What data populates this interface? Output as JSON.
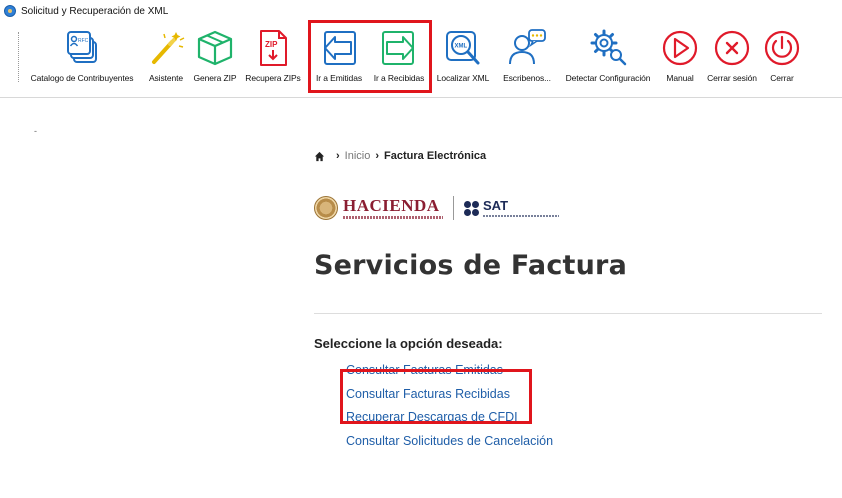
{
  "window": {
    "title": "Solicitud y Recuperación de XML"
  },
  "toolbar": {
    "buttons": [
      {
        "label": "Catalogo de Contribuyentes",
        "icon": "rfc-cards-icon",
        "badge": "RFC"
      },
      {
        "label": "Asistente",
        "icon": "magic-wand-icon"
      },
      {
        "label": "Genera ZIP",
        "icon": "box-icon"
      },
      {
        "label": "Recupera ZIPs",
        "icon": "zip-file-icon",
        "badge": "ZIP"
      },
      {
        "label": "Ir a Emitidas",
        "icon": "arrow-left-icon"
      },
      {
        "label": "Ir a Recibidas",
        "icon": "arrow-right-icon"
      },
      {
        "label": "Localizar XML",
        "icon": "xml-search-icon",
        "badge": "XML"
      },
      {
        "label": "Escribenos...",
        "icon": "chat-user-icon"
      },
      {
        "label": "Detectar Configuración",
        "icon": "gear-search-icon"
      },
      {
        "label": "Manual",
        "icon": "play-circle-icon"
      },
      {
        "label": "Cerrar sesión",
        "icon": "x-circle-icon"
      },
      {
        "label": "Cerrar",
        "icon": "power-icon"
      }
    ]
  },
  "content": {
    "side_marker": "-",
    "breadcrumb": {
      "home": "Inicio",
      "current": "Factura Electrónica"
    },
    "logos": {
      "hacienda": "HACIENDA",
      "sat": "SAT"
    },
    "heading": "Servicios de Factura",
    "prompt": "Seleccione la opción deseada:",
    "options": [
      "Consultar Facturas Emitidas",
      "Consultar Facturas Recibidas",
      "Recuperar Descargas de CFDI",
      "Consultar Solicitudes de Cancelación"
    ]
  },
  "colors": {
    "accent_red": "#e0151c",
    "icon_blue": "#1f6fc2",
    "icon_green": "#1fb36b",
    "icon_red": "#e01a2a",
    "link_blue": "#1f5ea8",
    "hacienda_maroon": "#8b1e32",
    "sat_navy": "#1d2b57"
  }
}
